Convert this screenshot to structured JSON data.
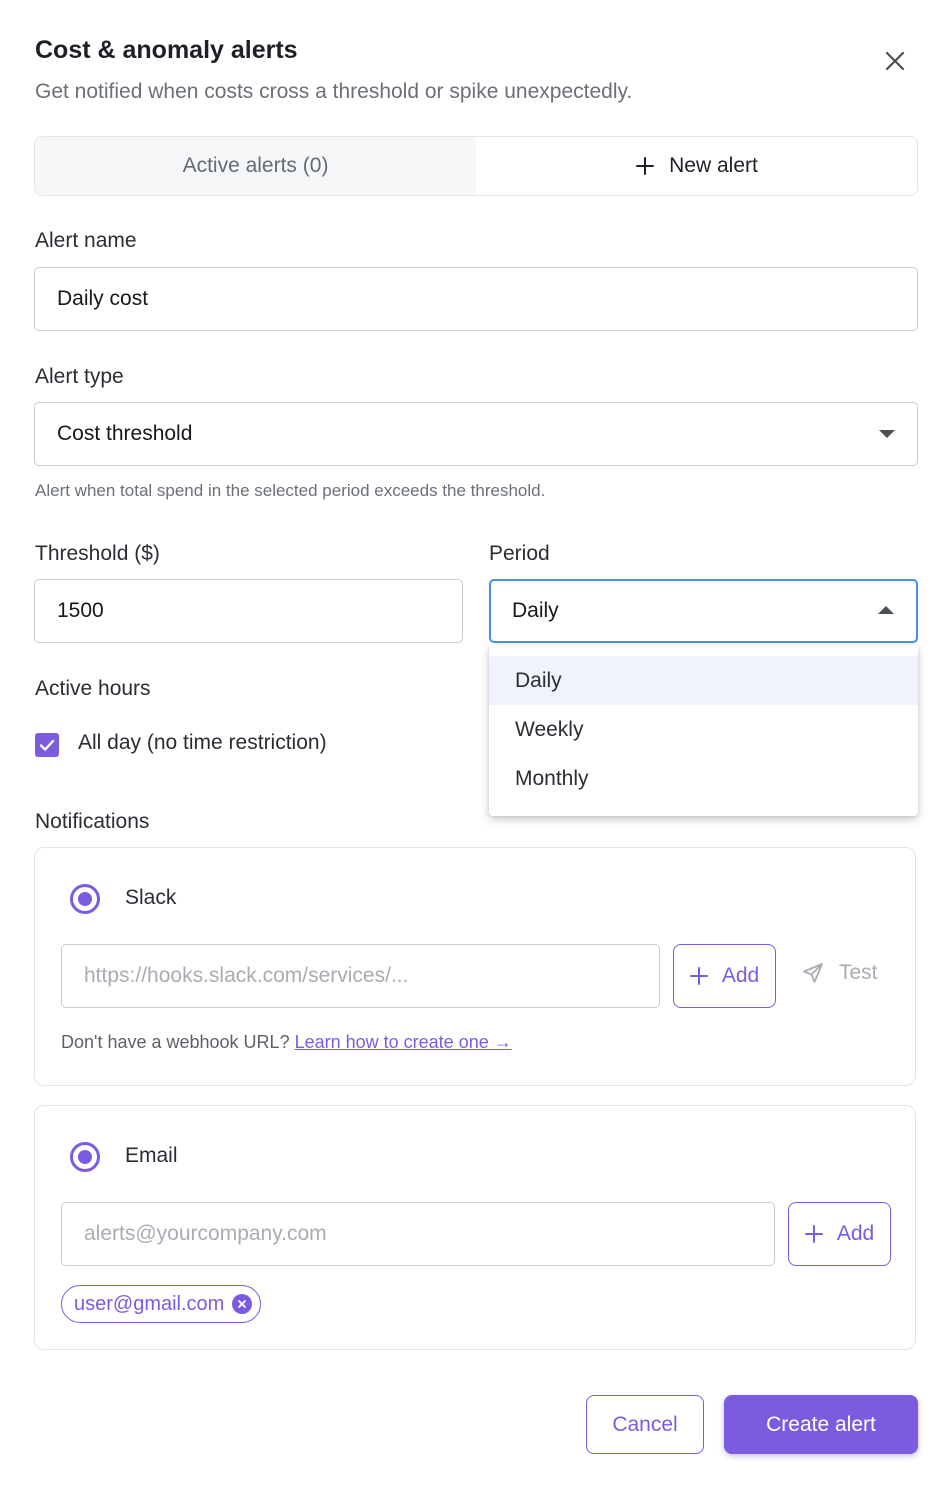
{
  "header": {
    "title": "Cost & anomaly alerts",
    "subtitle": "Get notified when costs cross a threshold or spike unexpectedly."
  },
  "tabs": [
    {
      "label": "Active alerts (0)",
      "active": false
    },
    {
      "label": "New alert",
      "active": true
    }
  ],
  "form": {
    "alert_name": {
      "label": "Alert name",
      "value": "Daily cost"
    },
    "alert_type": {
      "label": "Alert type",
      "value": "Cost threshold",
      "help": "Alert when total spend in the selected period exceeds the threshold."
    },
    "threshold": {
      "label": "Threshold ($)",
      "value": "1500"
    },
    "period": {
      "label": "Period",
      "value": "Daily",
      "options": [
        "Daily",
        "Weekly",
        "Monthly"
      ],
      "open": true
    },
    "active_hours": {
      "label": "Active hours",
      "checkbox_label": "All day (no time restriction)",
      "checked": true
    }
  },
  "notifications": {
    "label": "Notifications",
    "slack": {
      "label": "Slack",
      "placeholder": "https://hooks.slack.com/services/...",
      "add_label": "Add",
      "test_label": "Test",
      "hint": "Don't have a webhook URL?",
      "link": "Learn how to create one →"
    },
    "email": {
      "label": "Email",
      "placeholder": "alerts@yourcompany.com",
      "add_label": "Add",
      "chips": [
        "user@gmail.com"
      ]
    }
  },
  "footer": {
    "cancel_label": "Cancel",
    "create_label": "Create alert"
  },
  "colors": {
    "accent": "#7b5ce0",
    "border": "#c9ccd1",
    "focus": "#4a90e2"
  }
}
